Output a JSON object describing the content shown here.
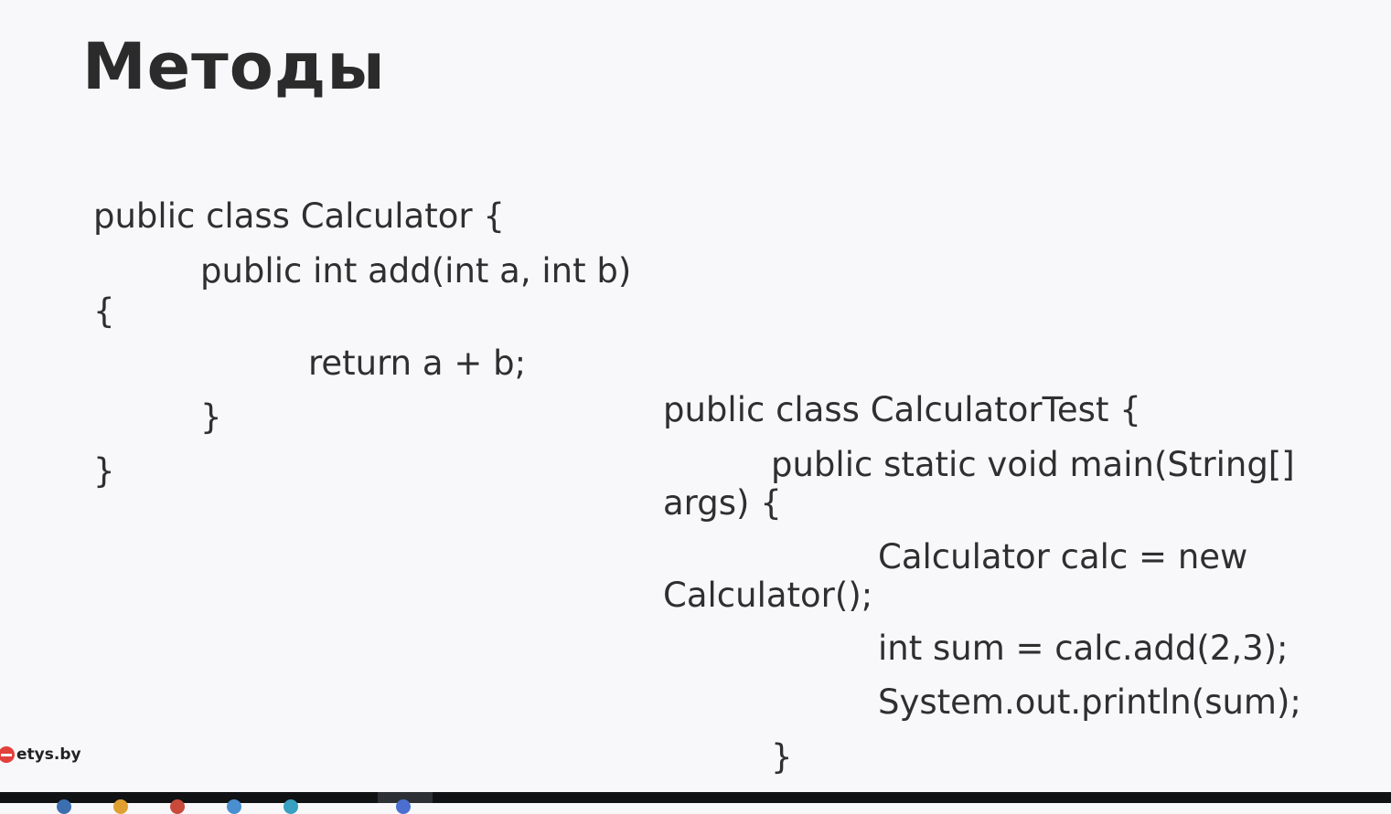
{
  "slide": {
    "title": "Методы",
    "calculator_code": [
      "public class Calculator {",
      "public int add(int a, int b)",
      "{",
      "return a + b;",
      "}",
      "}"
    ],
    "test_code": [
      "public class CalculatorTest {",
      "public static void main(String[]",
      "args) {",
      "Calculator calc = new",
      "Calculator();",
      "int sum = calc.add(2,3);",
      "System.out.println(sum);",
      "}"
    ]
  },
  "logo": {
    "text": "etys.by",
    "color": "#e2403a"
  },
  "taskbar": {
    "background": "#101214"
  }
}
